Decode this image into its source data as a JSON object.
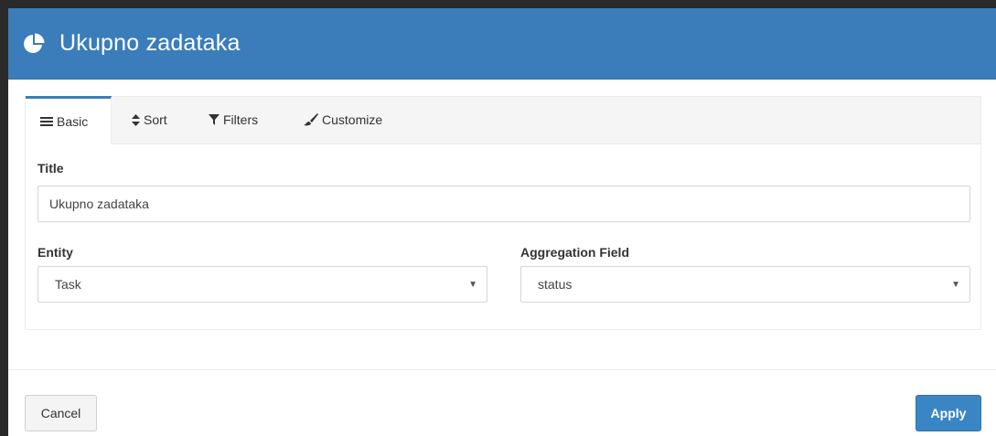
{
  "header": {
    "title": "Ukupno zadataka",
    "icon": "pie-chart-icon",
    "color": "#3a7dba"
  },
  "tabs": [
    {
      "label": "Basic",
      "icon": "bars-icon",
      "active": true
    },
    {
      "label": "Sort",
      "icon": "sort-icon",
      "active": false
    },
    {
      "label": "Filters",
      "icon": "filter-icon",
      "active": false
    },
    {
      "label": "Customize",
      "icon": "brush-icon",
      "active": false
    }
  ],
  "form": {
    "title_label": "Title",
    "title_value": "Ukupno zadataka",
    "entity_label": "Entity",
    "entity_value": "Task",
    "aggregation_label": "Aggregation Field",
    "aggregation_value": "status"
  },
  "footer": {
    "cancel_label": "Cancel",
    "apply_label": "Apply"
  }
}
